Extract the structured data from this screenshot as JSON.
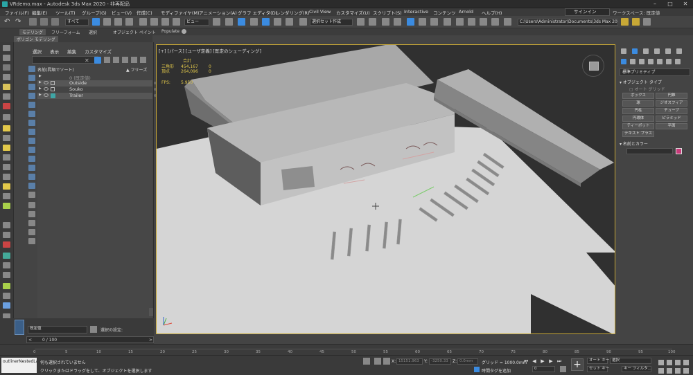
{
  "window": {
    "title": "VRdemo.max - Autodesk 3ds Max 2020 - 非再配品"
  },
  "menu": {
    "items": [
      "ファイル(F)",
      "編集(E)",
      "ツール(T)",
      "グループ(G)",
      "ビュー(V)",
      "作成(C)",
      "モディファイヤ(M)",
      "アニメーション(A)",
      "グラフ エディタ(D)",
      "レンダリング(R)",
      "Civil View",
      "カスタマイズ(U)",
      "スクリプト(S)",
      "Interactive",
      "コンテンツ",
      "Arnold",
      "ヘルプ(H)"
    ],
    "signin": "サインイン",
    "workspace_label": "ワークスペース: 既定値"
  },
  "toolbar": {
    "filter": "すべて",
    "view": "ビュー",
    "selection_set": "選択セット作成",
    "path": "C:\\Users\\Administrator\\Documents\\3ds Max 2020"
  },
  "ribbon": {
    "tabs": [
      "モデリング",
      "フリーフォーム",
      "選択",
      "オブジェクト ペイント",
      "Populate"
    ],
    "subtab": "ポリゴン モデリング"
  },
  "explorer": {
    "menu": [
      "選択",
      "表示",
      "編集",
      "カスタマイズ"
    ],
    "header_name": "名前(昇順でソート)",
    "header_freeze": "▲ フリーズ",
    "rows": [
      {
        "label": "0 (既定値)",
        "selected": false
      },
      {
        "label": "Outside",
        "selected": true
      },
      {
        "label": "Souko",
        "selected": false
      },
      {
        "label": "Trailer",
        "selected": true
      }
    ],
    "layer_dropdown": "既定値",
    "selection_setting": "選択の設定:"
  },
  "viewport": {
    "label": "[+] [パース] [ユーザ定義] [既定のシェーディング]",
    "stats": {
      "total_label": "合計",
      "tris_label": "三角形",
      "tris_value": "454,167",
      "tris_sel": "0",
      "verts_label": "頂点",
      "verts_value": "264,096",
      "verts_sel": "0",
      "fps_label": "FPS:",
      "fps_value": "5.950"
    }
  },
  "command_panel": {
    "dropdown": "標準プリミティブ",
    "object_type_label": "オブジェクト タイプ",
    "autogrid_label": "オート グリッド",
    "buttons": [
      "ボックス",
      "円錐",
      "球",
      "ジオスフィア",
      "円柱",
      "チューブ",
      "円環体",
      "ピラミッド",
      "ティーポット",
      "平面",
      "テキスト プラス"
    ],
    "name_color_label": "名前とカラー",
    "object_color": "#c83a7a"
  },
  "timeline": {
    "slider": "0 / 100",
    "ticks": [
      "0",
      "5",
      "10",
      "15",
      "20",
      "25",
      "30",
      "35",
      "40",
      "45",
      "50",
      "55",
      "60",
      "65",
      "70",
      "75",
      "80",
      "85",
      "90",
      "95",
      "100"
    ]
  },
  "status": {
    "maxscript": "outlinerNestedLa",
    "line1": "何も選択されていません",
    "line2": "クリックまたはドラッグをして、オブジェクトを選択します",
    "x_label": "X:",
    "x_value": "15151.963",
    "y_label": "Y:",
    "y_value": "-3250.33",
    "z_label": "Z:",
    "z_value": "0.0mm",
    "grid": "グリッド = 1000.0mm",
    "time_tag": "時間タグを追加",
    "auto_key": "オート キー",
    "set_key": "セット キー",
    "selection_dropdown": "選択",
    "key_filter": "キー フィルタ...",
    "frame": "0"
  },
  "colors": {
    "viewport_border": "#c8a836",
    "stats_text": "#e2c84a",
    "accent_blue": "#5a7fa8"
  }
}
